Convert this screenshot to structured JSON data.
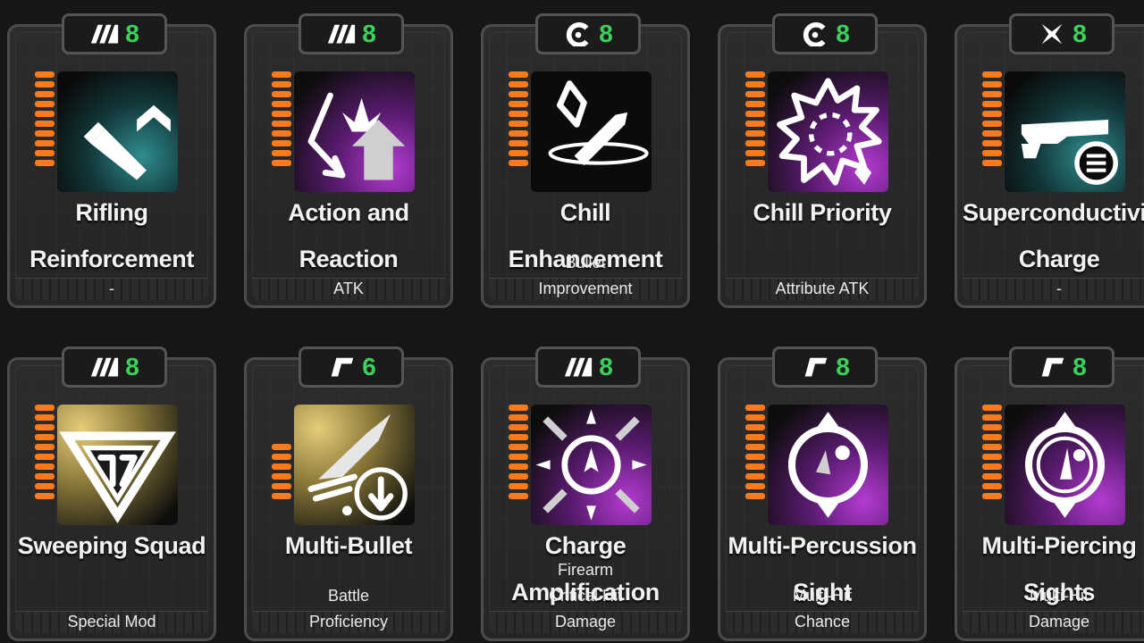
{
  "cards": [
    {
      "tab_icon": "stripes-rank-icon",
      "tab_value": "8",
      "pips": 10,
      "art": "bullet-upgrade-icon",
      "art_bg": "teal",
      "name_lines": [
        "Rifling",
        "Reinforcement"
      ],
      "category_lines": [
        "-"
      ]
    },
    {
      "tab_icon": "stripes-rank-icon",
      "tab_value": "8",
      "pips": 10,
      "art": "action-reaction-icon",
      "art_bg": "purple",
      "name_lines": [
        "Action and",
        "Reaction"
      ],
      "category_lines": [
        "ATK"
      ]
    },
    {
      "tab_icon": "c-rank-icon",
      "tab_value": "8",
      "pips": 10,
      "art": "chill-bullet-icon",
      "art_bg": "black",
      "name_lines": [
        "Chill",
        "Enhancement"
      ],
      "category_lines": [
        "Bullet",
        "Improvement"
      ]
    },
    {
      "tab_icon": "c-rank-icon",
      "tab_value": "8",
      "pips": 10,
      "art": "chill-priority-icon",
      "art_bg": "purple",
      "name_lines": [
        "Chill Priority"
      ],
      "category_lines": [
        "Attribute ATK"
      ]
    },
    {
      "tab_icon": "x-rank-icon",
      "tab_value": "8",
      "pips": 10,
      "art": "gun-charge-icon",
      "art_bg": "teal",
      "name_lines": [
        "Superconductivity",
        "Charge"
      ],
      "category_lines": [
        "-"
      ]
    },
    {
      "tab_icon": "stripes-rank-icon",
      "tab_value": "8",
      "pips": 10,
      "art": "triangle-emblem-icon",
      "art_bg": "gold",
      "name_lines": [
        "Sweeping Squad"
      ],
      "category_lines": [
        "Special Mod"
      ]
    },
    {
      "tab_icon": "r-rank-icon",
      "tab_value": "6",
      "pips": 6,
      "art": "multi-bullet-icon",
      "art_bg": "gold",
      "name_lines": [
        "Multi-Bullet"
      ],
      "category_lines": [
        "Battle",
        "Proficiency"
      ]
    },
    {
      "tab_icon": "stripes-rank-icon",
      "tab_value": "8",
      "pips": 10,
      "art": "charge-amplification-icon",
      "art_bg": "purple",
      "name_lines": [
        "Charge",
        "Amplification"
      ],
      "category_lines": [
        "Firearm",
        "Critical Hit",
        "Damage"
      ]
    },
    {
      "tab_icon": "r-rank-icon",
      "tab_value": "8",
      "pips": 10,
      "art": "percussion-sight-icon",
      "art_bg": "purple",
      "name_lines": [
        "Multi-Percussion",
        "Sight"
      ],
      "category_lines": [
        "Multi-Hit",
        "Chance"
      ]
    },
    {
      "tab_icon": "r-rank-icon",
      "tab_value": "8",
      "pips": 10,
      "art": "piercing-sight-icon",
      "art_bg": "purple",
      "name_lines": [
        "Multi-Piercing",
        "Sights"
      ],
      "category_lines": [
        "Multi-Hit",
        "Damage"
      ]
    }
  ]
}
